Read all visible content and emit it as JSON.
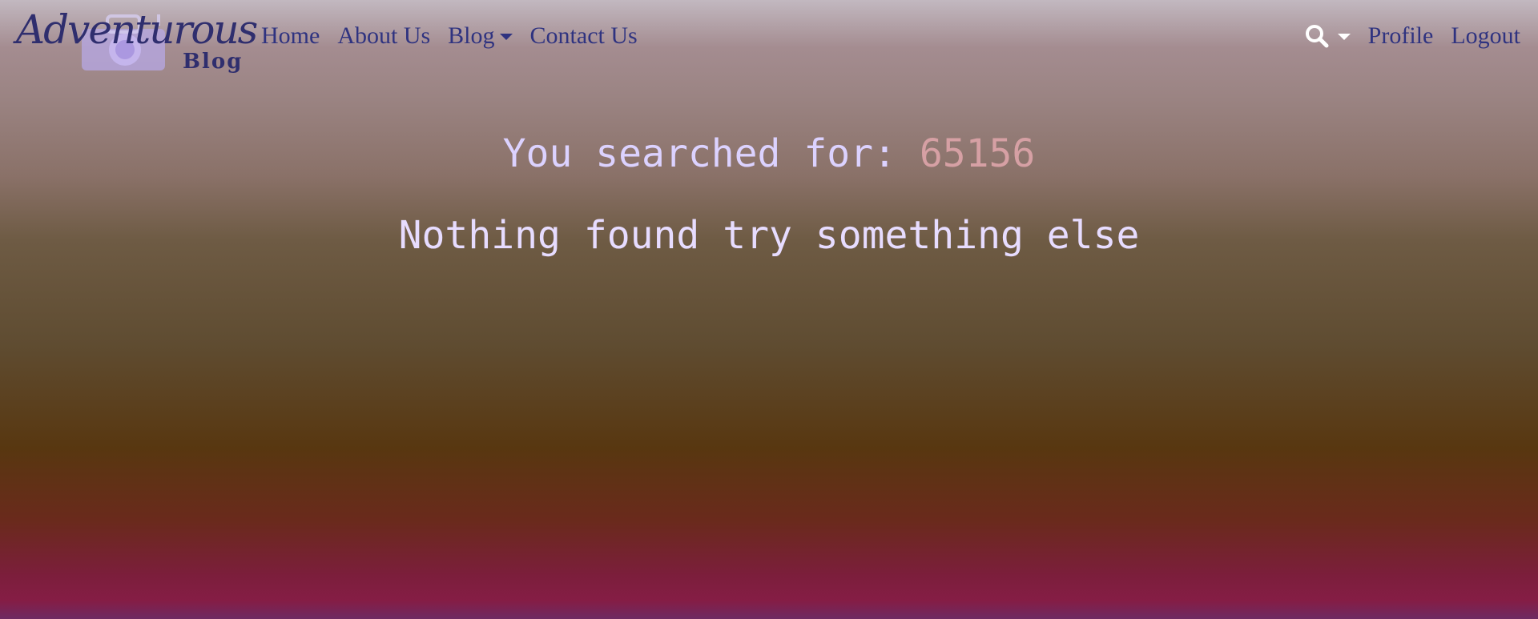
{
  "brand": {
    "name_script": "Adventurous",
    "name_sub": "Blog"
  },
  "nav": {
    "left": [
      {
        "label": "Home"
      },
      {
        "label": "About Us"
      },
      {
        "label": "Blog",
        "dropdown": true
      },
      {
        "label": "Contact Us"
      }
    ],
    "search_icon": "search-icon",
    "right": [
      {
        "label": "Profile"
      },
      {
        "label": "Logout"
      }
    ]
  },
  "search": {
    "prefix": "You searched for: ",
    "term": "65156",
    "no_results_message": "Nothing found try something else"
  },
  "colors": {
    "nav_link": "#2f3380",
    "heading": "#dcd2ff",
    "search_term": "#d6a0a4"
  }
}
